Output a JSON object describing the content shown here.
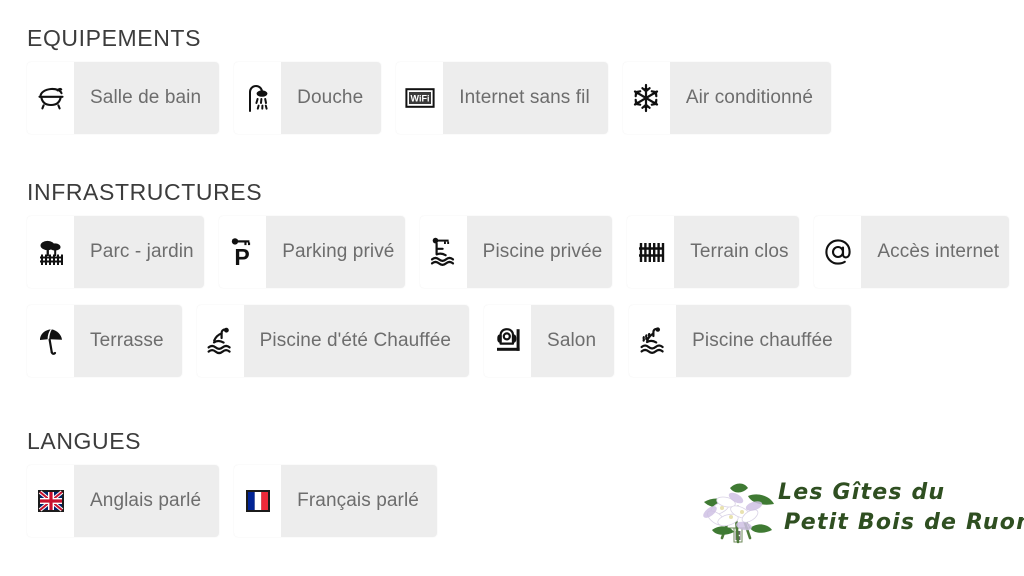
{
  "sections": [
    {
      "title": "EQUIPEMENTS",
      "rows": [
        [
          {
            "label": "Salle de bain",
            "icon": "bathtub-icon"
          },
          {
            "label": "Douche",
            "icon": "shower-icon"
          },
          {
            "label": "Internet sans fil",
            "icon": "wifi-icon"
          },
          {
            "label": "Air conditionné",
            "icon": "snowflake-icon"
          }
        ]
      ]
    },
    {
      "title": "INFRASTRUCTURES",
      "rows": [
        [
          {
            "label": "Parc - jardin",
            "icon": "tree-fence-icon"
          },
          {
            "label": "Parking privé",
            "icon": "parking-key-icon"
          },
          {
            "label": "Piscine privée",
            "icon": "pool-key-icon"
          },
          {
            "label": "Terrain clos",
            "icon": "fence-icon"
          },
          {
            "label": "Accès internet",
            "icon": "at-sign-icon"
          }
        ],
        [
          {
            "label": "Terrasse",
            "icon": "parasol-icon"
          },
          {
            "label": "Piscine d'été Chauffée",
            "icon": "pool-diver-icon"
          },
          {
            "label": "Salon",
            "icon": "armchair-icon"
          },
          {
            "label": "Piscine chauffée",
            "icon": "heated-pool-icon"
          }
        ]
      ]
    },
    {
      "title": "LANGUES",
      "rows": [
        [
          {
            "label": "Anglais parlé",
            "icon": "uk-flag-icon"
          },
          {
            "label": "Français parlé",
            "icon": "fr-flag-icon"
          }
        ]
      ]
    }
  ],
  "logo": {
    "line1": "Les Gîtes du",
    "line2": "Petit Bois de Ruoms",
    "color": "#2f4f21",
    "art": "flower-bouquet-icon"
  },
  "colors": {
    "page_background": "#ffffff",
    "tile_label_background": "#ededed",
    "tile_icon_background": "#ffffff",
    "heading_text": "#3c3c3c",
    "label_text": "#6d6d6d",
    "icon_ink": "#111111"
  }
}
